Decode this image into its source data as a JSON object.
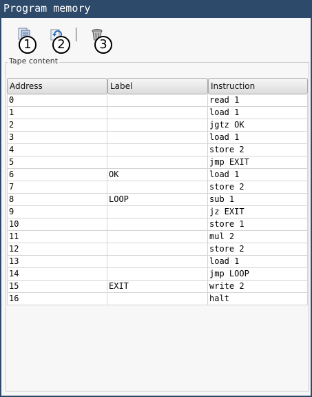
{
  "window": {
    "title": "Program memory"
  },
  "toolbar": {
    "buttons": [
      {
        "icon": "open-document-icon",
        "badge": "1"
      },
      {
        "icon": "reload-icon",
        "badge": "2"
      },
      {
        "icon": "trash-icon",
        "badge": "3"
      }
    ]
  },
  "panel": {
    "title": "Tape content"
  },
  "table": {
    "columns": [
      "Address",
      "Label",
      "Instruction"
    ],
    "rows": [
      {
        "address": "0",
        "label": "",
        "instruction": "read 1"
      },
      {
        "address": "1",
        "label": "",
        "instruction": "load 1"
      },
      {
        "address": "2",
        "label": "",
        "instruction": "jgtz OK"
      },
      {
        "address": "3",
        "label": "",
        "instruction": "load 1"
      },
      {
        "address": "4",
        "label": "",
        "instruction": "store 2"
      },
      {
        "address": "5",
        "label": "",
        "instruction": "jmp EXIT"
      },
      {
        "address": "6",
        "label": "OK",
        "instruction": "load 1"
      },
      {
        "address": "7",
        "label": "",
        "instruction": "store 2"
      },
      {
        "address": "8",
        "label": "LOOP",
        "instruction": "sub 1"
      },
      {
        "address": "9",
        "label": "",
        "instruction": "jz EXIT"
      },
      {
        "address": "10",
        "label": "",
        "instruction": "store 1"
      },
      {
        "address": "11",
        "label": "",
        "instruction": "mul 2"
      },
      {
        "address": "12",
        "label": "",
        "instruction": "store 2"
      },
      {
        "address": "13",
        "label": "",
        "instruction": "load 1"
      },
      {
        "address": "14",
        "label": "",
        "instruction": "jmp LOOP"
      },
      {
        "address": "15",
        "label": "EXIT",
        "instruction": "write 2"
      },
      {
        "address": "16",
        "label": "",
        "instruction": "halt"
      }
    ]
  }
}
